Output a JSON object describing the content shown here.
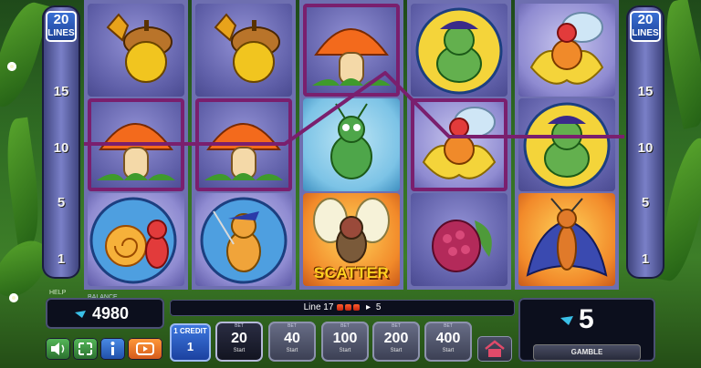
{
  "side_panels": {
    "lines_count": "20",
    "lines_label": "LINES",
    "line_numbers": [
      "15",
      "10",
      "5",
      "1"
    ]
  },
  "reels": [
    {
      "symbols": [
        "acorn",
        "mushroom",
        "snail"
      ]
    },
    {
      "symbols": [
        "acorn",
        "mushroom",
        "musketeer-bug"
      ]
    },
    {
      "symbols": [
        "mushroom",
        "grasshopper",
        "scatter-fly"
      ]
    },
    {
      "symbols": [
        "pirate-caterpillar",
        "firefly-lantern",
        "raspberry"
      ]
    },
    {
      "symbols": [
        "firefly-lantern",
        "pirate-caterpillar",
        "batwing-ant"
      ]
    }
  ],
  "scatter_label": "SCATTER",
  "winning_line": {
    "number": 17,
    "symbol": "mushroom",
    "count": 3,
    "win": "5",
    "color": "#7a1f6e"
  },
  "console": {
    "help_label": "HELP",
    "balance_label": "BALANCE",
    "balance_value": "4980",
    "info_line_label": "Line 17",
    "info_win": "5",
    "credit_label": "1 CREDIT",
    "credit_value": "1",
    "bets": [
      {
        "label": "BET",
        "value": "20",
        "start": "Start",
        "active": true
      },
      {
        "label": "BET",
        "value": "40",
        "start": "Start",
        "active": false
      },
      {
        "label": "BET",
        "value": "100",
        "start": "Start",
        "active": false
      },
      {
        "label": "BET",
        "value": "200",
        "start": "Start",
        "active": false
      },
      {
        "label": "BET",
        "value": "400",
        "start": "Start",
        "active": false
      }
    ],
    "gamble_value": "5",
    "gamble_label": "GAMBLE"
  },
  "icons": [
    "sound-icon",
    "fullscreen-icon",
    "info-icon",
    "autoplay-icon",
    "home-icon",
    "coin-icon"
  ],
  "colors": {
    "accent": "#1d3f92",
    "reel_bg": "#6e6fb0",
    "console_bg": "#0c0f1d"
  }
}
